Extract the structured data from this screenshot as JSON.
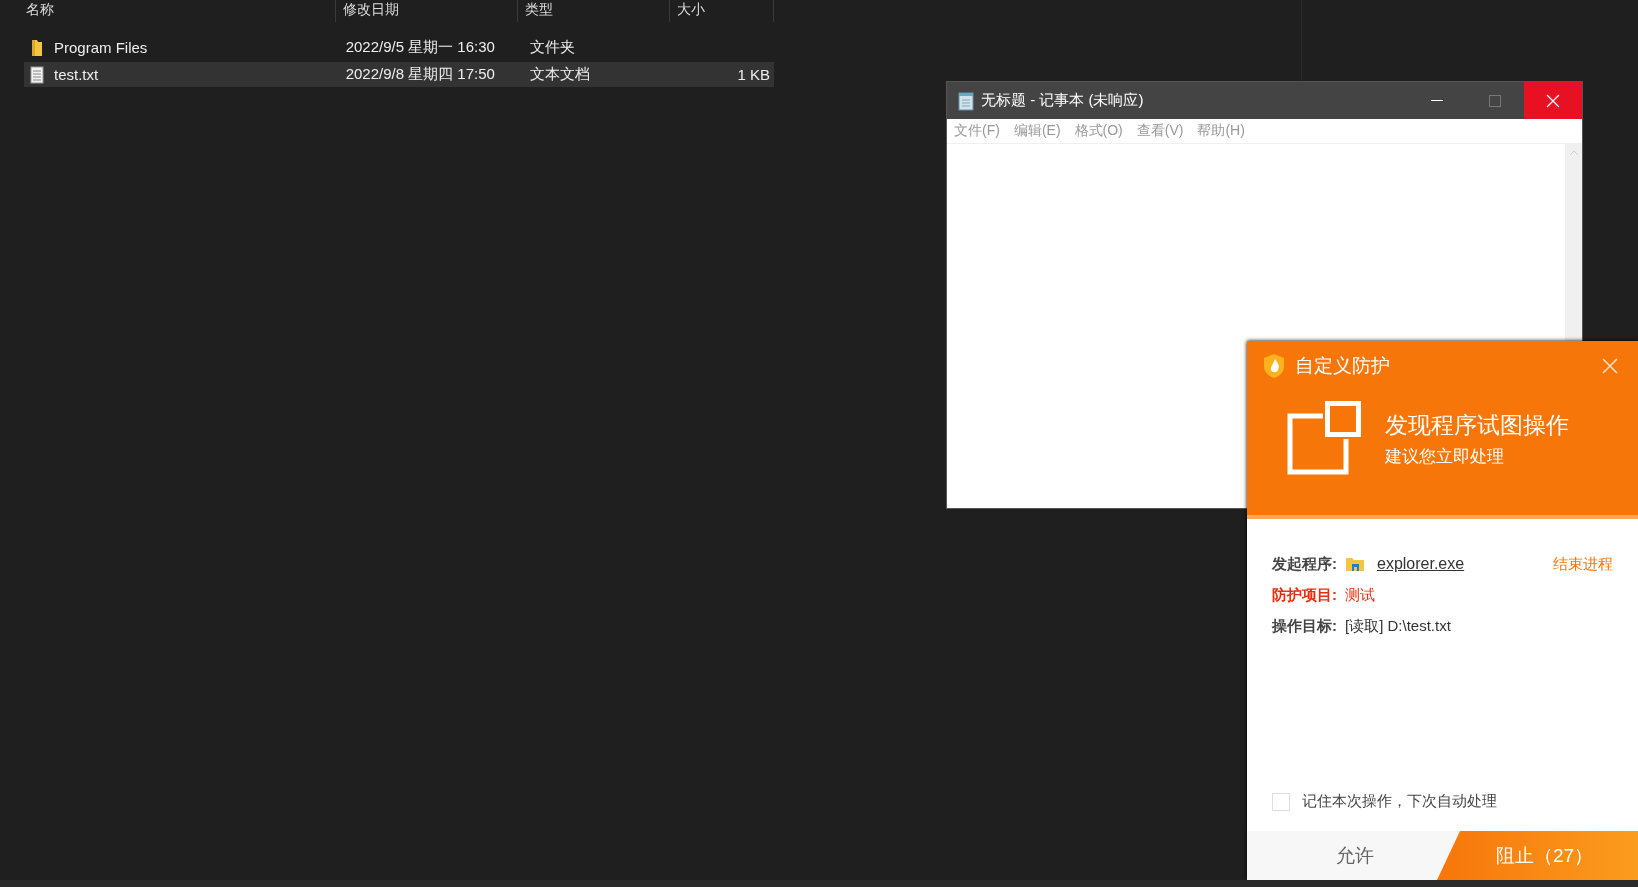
{
  "explorer": {
    "columns": [
      "名称",
      "修改日期",
      "类型",
      "大小"
    ],
    "rows": [
      {
        "kind": "folder",
        "name": "Program Files",
        "date": "2022/9/5 星期一 16:30",
        "type": "文件夹",
        "selected": false
      },
      {
        "kind": "file",
        "name": "test.txt",
        "date": "2022/9/8 星期四 17:50",
        "type": "文本文档",
        "size": "1 KB",
        "selected": true
      }
    ]
  },
  "notepad": {
    "title": "无标题 - 记事本 (未响应)",
    "menu": [
      "文件(F)",
      "编辑(E)",
      "格式(O)",
      "查看(V)",
      "帮助(H)"
    ]
  },
  "popup": {
    "title": "自定义防护",
    "headline": "发现程序试图操作",
    "subline": "建议您立即处理",
    "fields": [
      {
        "kind": "program",
        "label": "发起程序:",
        "value": "explorer.exe"
      },
      {
        "kind": "alert",
        "label": "防护项目:",
        "value": "测试"
      },
      {
        "kind": "plain",
        "label": "操作目标:",
        "value": "[读取] D:\\test.txt"
      }
    ],
    "end_process": "结束进程",
    "remember": {
      "label": "记住本次操作，下次自动处理",
      "checked": false
    },
    "allow": "允许",
    "block": "阻止（27）"
  }
}
